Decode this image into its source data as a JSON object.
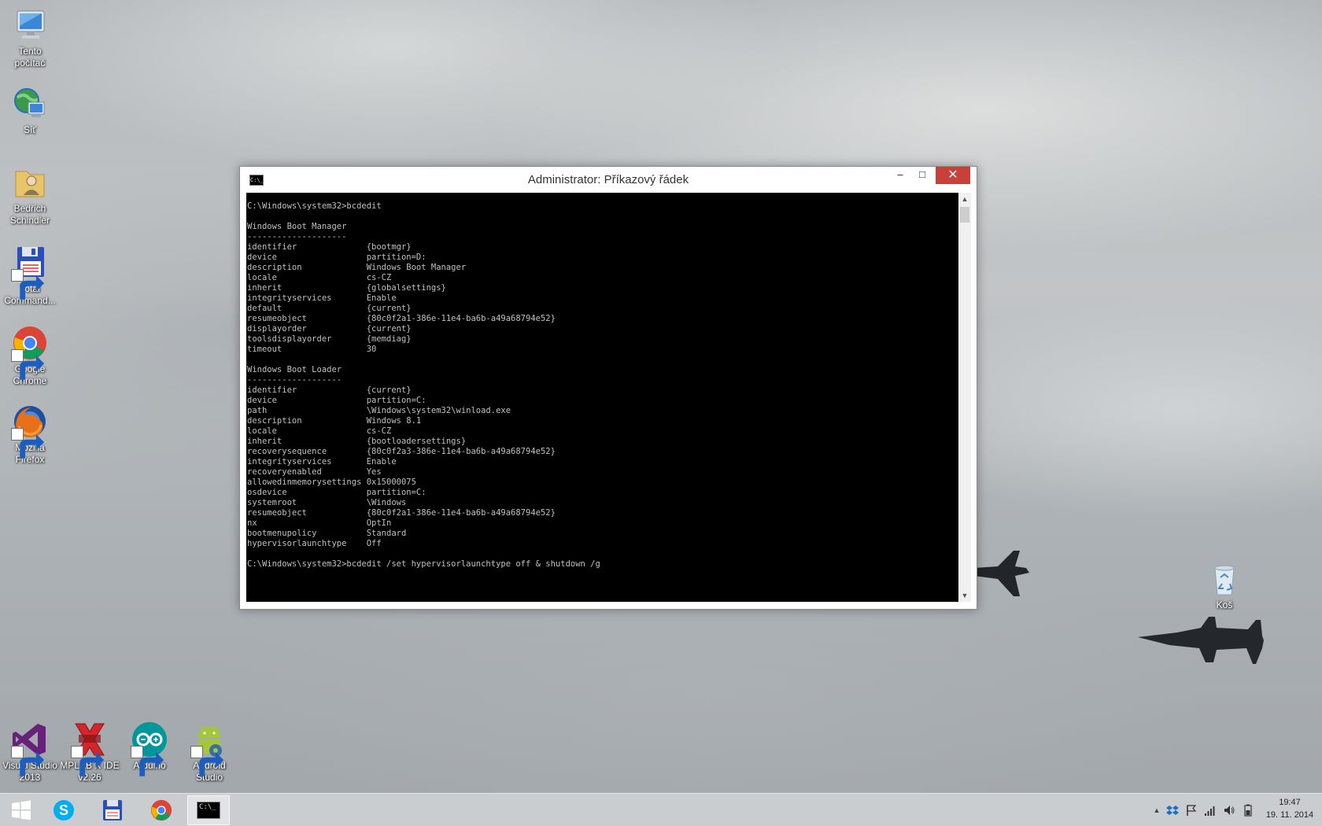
{
  "desktop": {
    "icons": [
      {
        "label": "Tento počítač",
        "line1": "Tento",
        "line2": "počítač"
      },
      {
        "label": "Síť",
        "line1": "Síť",
        "line2": ""
      },
      {
        "label": "Bedřich Schindler",
        "line1": "Bedřich",
        "line2": "Schindler"
      },
      {
        "label": "Total Command...",
        "line1": "Total",
        "line2": "Command..."
      },
      {
        "label": "Google Chrome",
        "line1": "Google",
        "line2": "Chrome"
      },
      {
        "label": "Mozilla Firefox",
        "line1": "Mozilla",
        "line2": "Firefox"
      },
      {
        "label": "Visual Studio 2013",
        "line1": "Visual Studio",
        "line2": "2013"
      },
      {
        "label": "MPLAB X IDE v2.26",
        "line1": "MPLAB X IDE",
        "line2": "v2.26"
      },
      {
        "label": "Arduino",
        "line1": "Arduino",
        "line2": ""
      },
      {
        "label": "Android Studio",
        "line1": "Android",
        "line2": "Studio"
      },
      {
        "label": "Koš",
        "line1": "Koš",
        "line2": ""
      }
    ]
  },
  "window": {
    "title": "Administrator: Příkazový řádek",
    "icon_text": "C:\\_",
    "minimize_glyph": "–",
    "maximize_glyph": "□",
    "close_glyph": "✕",
    "console_lines": [
      "C:\\Windows\\system32>bcdedit",
      "",
      "Windows Boot Manager",
      "--------------------",
      "identifier              {bootmgr}",
      "device                  partition=D:",
      "description             Windows Boot Manager",
      "locale                  cs-CZ",
      "inherit                 {globalsettings}",
      "integrityservices       Enable",
      "default                 {current}",
      "resumeobject            {80c0f2a1-386e-11e4-ba6b-a49a68794e52}",
      "displayorder            {current}",
      "toolsdisplayorder       {memdiag}",
      "timeout                 30",
      "",
      "Windows Boot Loader",
      "-------------------",
      "identifier              {current}",
      "device                  partition=C:",
      "path                    \\Windows\\system32\\winload.exe",
      "description             Windows 8.1",
      "locale                  cs-CZ",
      "inherit                 {bootloadersettings}",
      "recoverysequence        {80c0f2a3-386e-11e4-ba6b-a49a68794e52}",
      "integrityservices       Enable",
      "recoveryenabled         Yes",
      "allowedinmemorysettings 0x15000075",
      "osdevice                partition=C:",
      "systemroot              \\Windows",
      "resumeobject            {80c0f2a1-386e-11e4-ba6b-a49a68794e52}",
      "nx                      OptIn",
      "bootmenupolicy          Standard",
      "hypervisorlaunchtype    Off",
      "",
      "C:\\Windows\\system32>bcdedit /set hypervisorlaunchtype off & shutdown /g"
    ]
  },
  "taskbar": {
    "clock_time": "19:47",
    "clock_date": "19. 11. 2014",
    "show_hidden_glyph": "▲",
    "apps": [
      "Start",
      "Skype",
      "Total Commander",
      "Google Chrome",
      "Příkazový řádek"
    ],
    "cmd_icon_text": "C:\\_"
  }
}
